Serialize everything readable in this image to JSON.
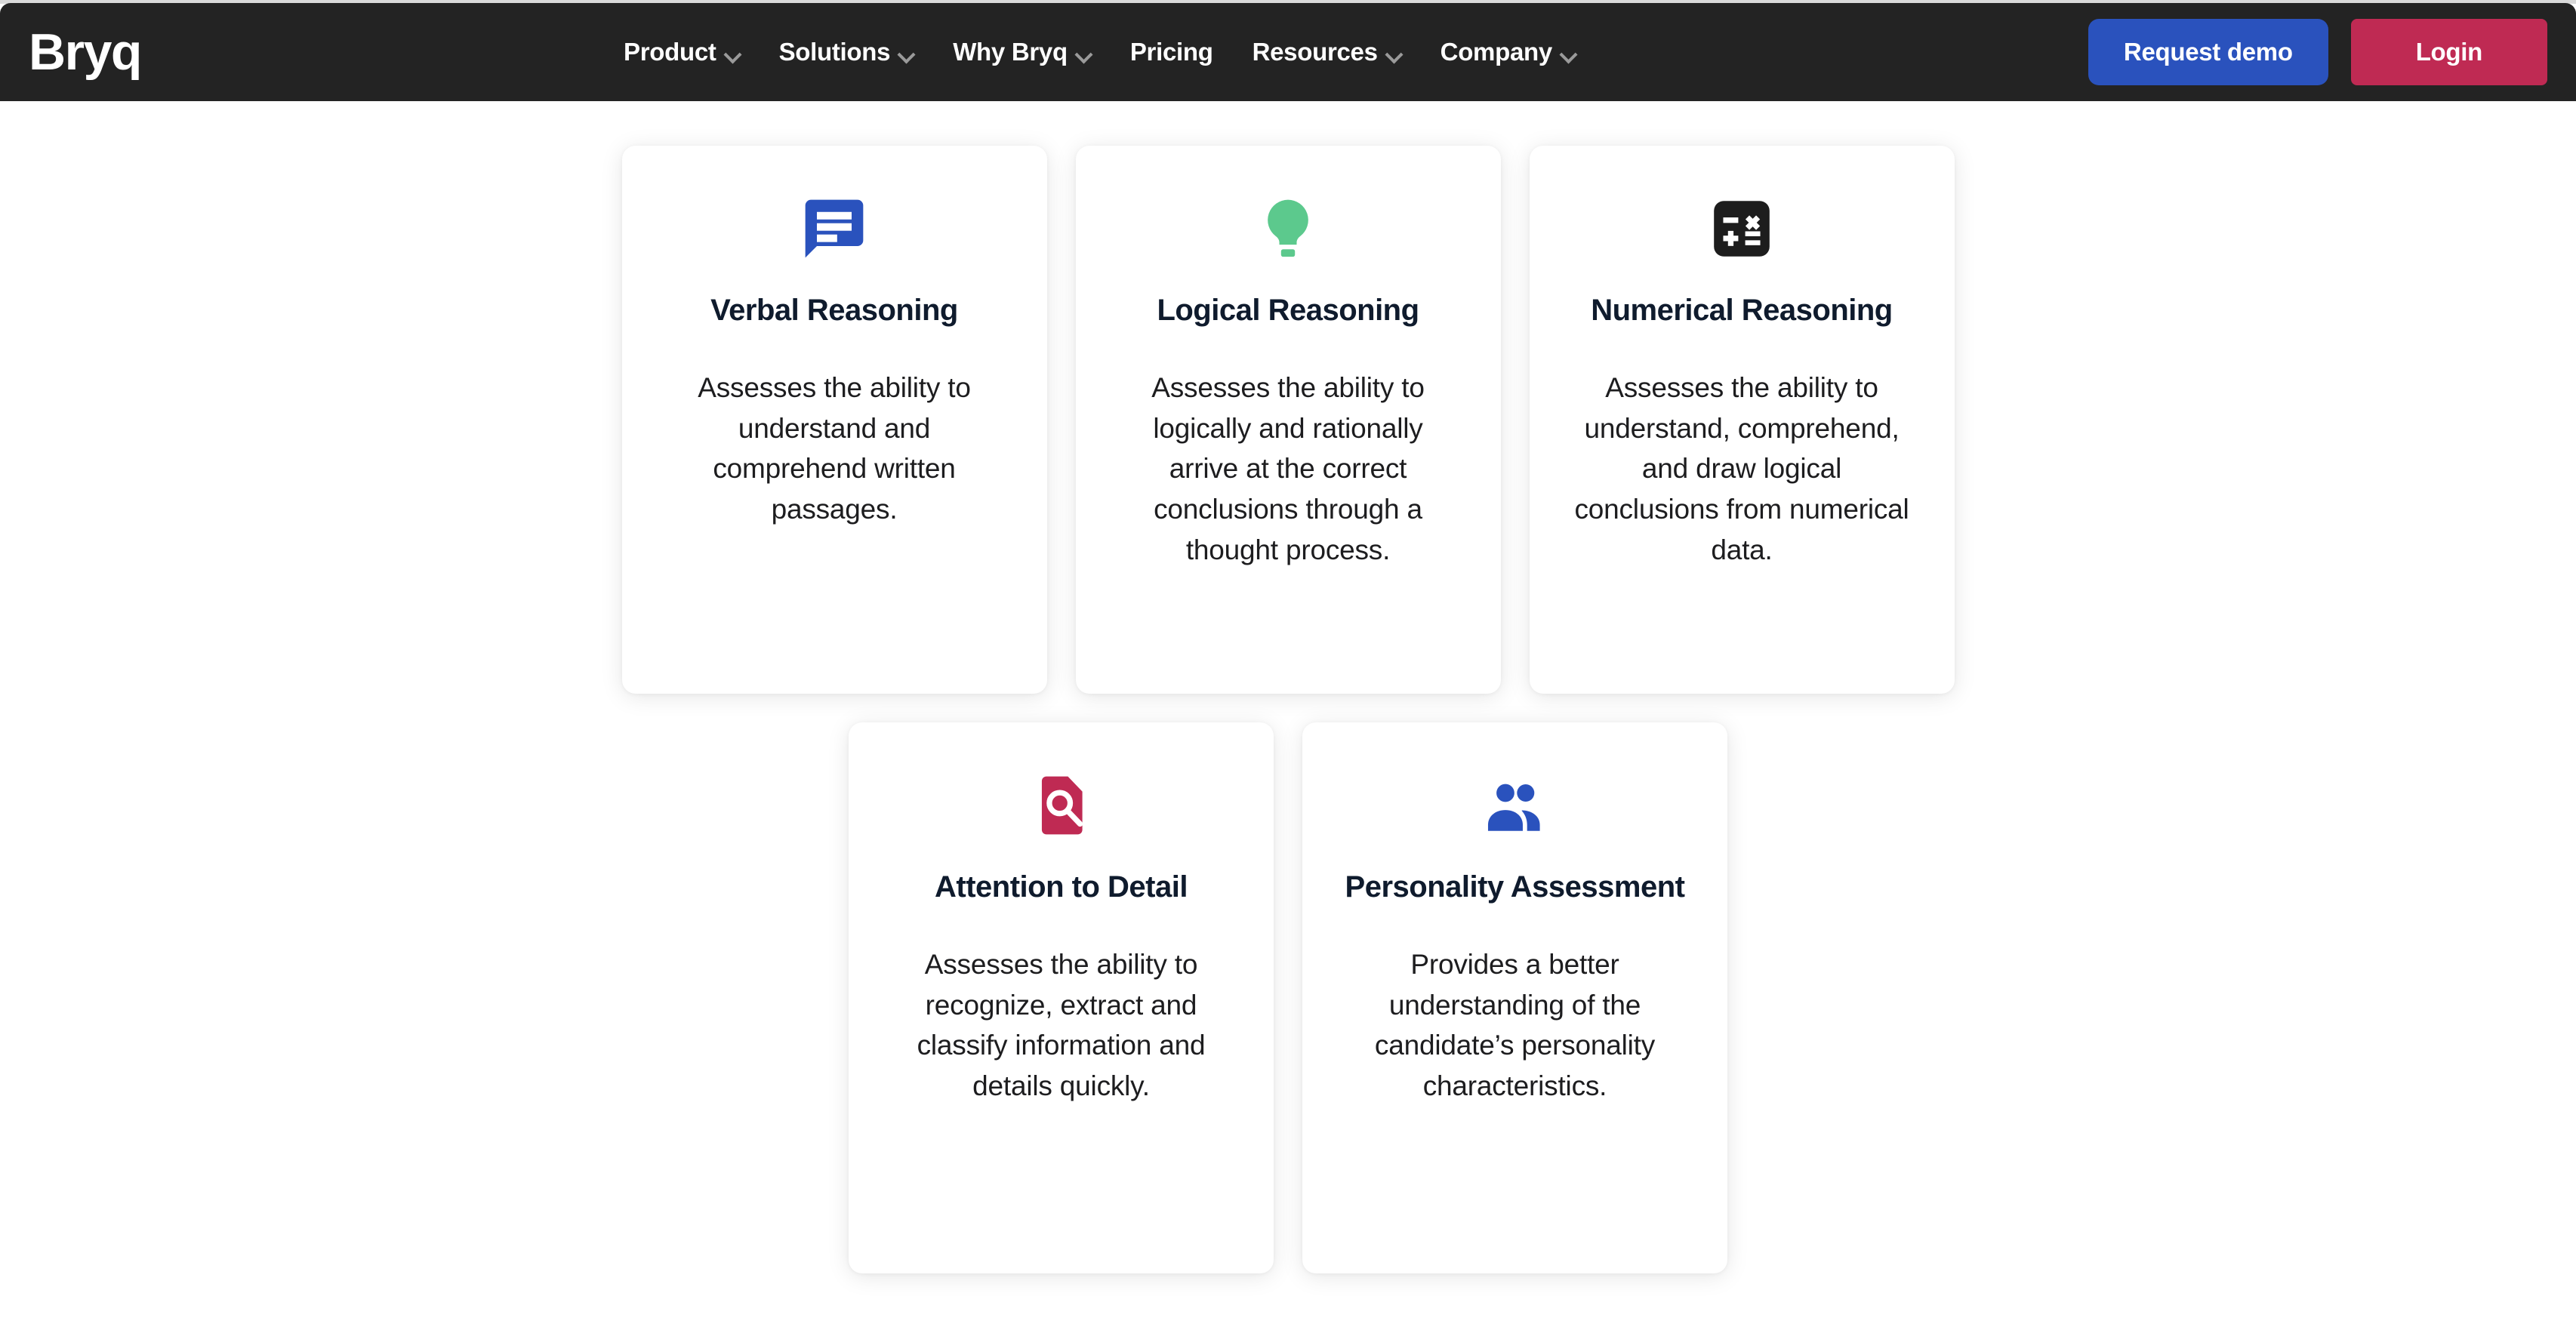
{
  "header": {
    "logo_text": "Bryq",
    "nav_items": [
      {
        "label": "Product",
        "has_caret": true
      },
      {
        "label": "Solutions",
        "has_caret": true
      },
      {
        "label": "Why Bryq",
        "has_caret": true
      },
      {
        "label": "Pricing",
        "has_caret": false
      },
      {
        "label": "Resources",
        "has_caret": true
      },
      {
        "label": "Company",
        "has_caret": true
      }
    ],
    "request_demo_label": "Request demo",
    "login_label": "Login",
    "background_color": "#232323",
    "demo_button_color": "#2a52bd",
    "login_button_color": "#bf2a53"
  },
  "cards": [
    {
      "title": "Verbal Reasoning",
      "description": "Assesses the ability to understand and comprehend written passages.",
      "icon": "chat-bubble-icon",
      "icon_color": "#2a52bd"
    },
    {
      "title": "Logical Reasoning",
      "description": "Assesses the ability to logically and rationally arrive at the correct conclusions through a thought process.",
      "icon": "lightbulb-icon",
      "icon_color": "#5cc98d"
    },
    {
      "title": "Numerical Reasoning",
      "description": "Assesses the ability to understand, comprehend, and draw logical conclusions from numerical data.",
      "icon": "calculator-icon",
      "icon_color": "#1d1d1d"
    },
    {
      "title": "Attention to Detail",
      "description": "Assesses the ability to recognize, extract and classify information and details quickly.",
      "icon": "document-search-icon",
      "icon_color": "#bf2a53"
    },
    {
      "title": "Personality Assessment",
      "description": "Provides a better understanding of the candidate’s personality characteristics.",
      "icon": "people-icon",
      "icon_color": "#2a52bd"
    }
  ]
}
